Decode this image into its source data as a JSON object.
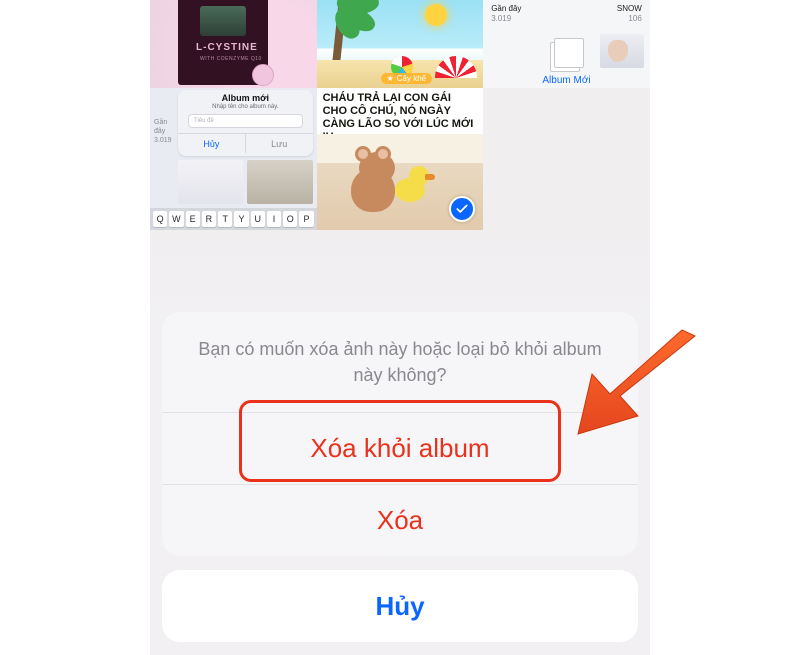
{
  "grid": {
    "tile1": {
      "brand": "L-CYSTINE",
      "sub": "WITH COENZYME Q10"
    },
    "tile2": {
      "badge": "Cây khế"
    },
    "tile3": {
      "left_title": "Gần đây",
      "left_count": "3.019",
      "right_title": "SNOW",
      "right_count": "106",
      "new_album": "Album Mới"
    },
    "tile4": {
      "side_title": "Gần đây",
      "side_count": "3.019",
      "dlg_title": "Album mới",
      "dlg_sub": "Nhập tên cho album này.",
      "placeholder": "Tiêu đề",
      "cancel": "Hủy",
      "save": "Lưu",
      "keys": [
        "Q",
        "W",
        "E",
        "R",
        "T",
        "Y",
        "U",
        "I",
        "O",
        "P"
      ]
    },
    "tile5": {
      "caption": "CHÁU TRẢ LẠI CON GÁI CHO CÔ CHÚ, NÓ NGÀY CÀNG LÃO SO VỚI LÚC MỚI IU"
    }
  },
  "sheet": {
    "prompt": "Bạn có muốn xóa ảnh này hoặc loại bỏ khỏi album này không?",
    "remove_from_album": "Xóa khỏi album",
    "delete": "Xóa",
    "cancel": "Hủy"
  }
}
